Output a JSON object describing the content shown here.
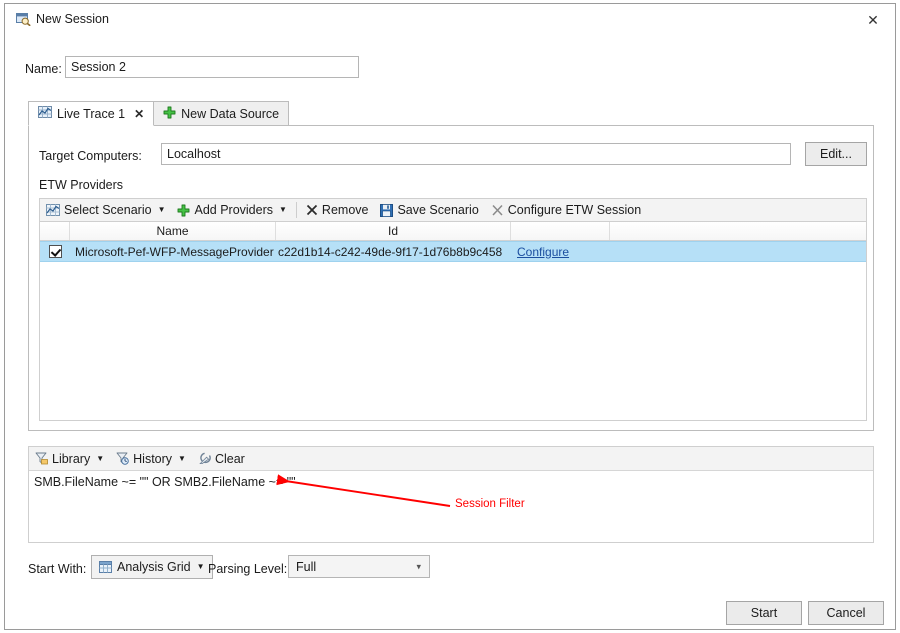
{
  "window": {
    "title": "New Session",
    "title_icon": "session-window-icon",
    "close_label": "✕"
  },
  "name_field": {
    "label": "Name:",
    "value": "Session 2",
    "placeholder": ""
  },
  "tabs": [
    {
      "label": "Live Trace 1",
      "icon": "live-trace-icon",
      "close": "✕",
      "active": true
    },
    {
      "label": "New Data Source",
      "icon": "plus-icon",
      "active": false
    }
  ],
  "target_computers": {
    "label": "Target Computers:",
    "value": "Localhost",
    "edit_label": "Edit..."
  },
  "etw": {
    "section_label": "ETW Providers",
    "toolbar": [
      {
        "label": "Select Scenario",
        "icon": "chart-icon",
        "caret": "▼"
      },
      {
        "label": "Add Providers",
        "icon": "green-plus-icon",
        "caret": "▼"
      },
      {
        "label": "Remove",
        "icon": "x-icon"
      },
      {
        "label": "Save Scenario",
        "icon": "save-disk-icon"
      },
      {
        "label": "Configure ETW Session",
        "icon": "scissors-icon"
      }
    ],
    "columns": [
      "",
      "Name",
      "Id",
      "",
      ""
    ],
    "rows": [
      {
        "checked": true,
        "name": "Microsoft-Pef-WFP-MessageProvider",
        "id": "c22d1b14-c242-49de-9f17-1d76b8b9c458",
        "configure": "Configure"
      }
    ]
  },
  "filter": {
    "toolbar": [
      {
        "label": "Library",
        "icon": "filter-folder-icon",
        "caret": "▼"
      },
      {
        "label": "History",
        "icon": "filter-clock-icon",
        "caret": "▼"
      },
      {
        "label": "Clear",
        "icon": "eraser-icon"
      }
    ],
    "expression": "SMB.FileName ~= \"\" OR SMB2.FileName ~= \"\""
  },
  "bottom": {
    "start_with_label": "Start With:",
    "start_with_value": "Analysis Grid",
    "start_with_icon": "grid-icon",
    "start_with_caret": "▼",
    "parsing_level_label": "Parsing Level:",
    "parsing_level_value": "Full",
    "parsing_level_arrow": "▾"
  },
  "dialog_buttons": {
    "start": "Start",
    "cancel": "Cancel"
  },
  "annotation": {
    "text": "Session Filter",
    "color": "#ff0000"
  }
}
